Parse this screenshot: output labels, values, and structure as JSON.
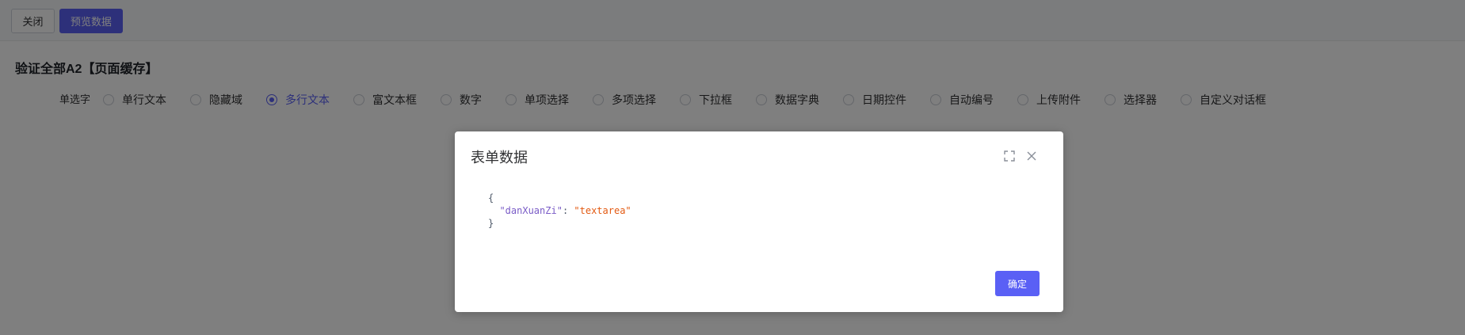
{
  "toolbar": {
    "close_label": "关闭",
    "preview_label": "预览数据"
  },
  "form": {
    "title": "验证全部A2【页面缓存】",
    "field_label": "单选字",
    "options": [
      {
        "label": "单行文本",
        "checked": false
      },
      {
        "label": "隐藏域",
        "checked": false
      },
      {
        "label": "多行文本",
        "checked": true
      },
      {
        "label": "富文本框",
        "checked": false
      },
      {
        "label": "数字",
        "checked": false
      },
      {
        "label": "单项选择",
        "checked": false
      },
      {
        "label": "多项选择",
        "checked": false
      },
      {
        "label": "下拉框",
        "checked": false
      },
      {
        "label": "数据字典",
        "checked": false
      },
      {
        "label": "日期控件",
        "checked": false
      },
      {
        "label": "自动编号",
        "checked": false
      },
      {
        "label": "上传附件",
        "checked": false
      },
      {
        "label": "选择器",
        "checked": false
      },
      {
        "label": "自定义对话框",
        "checked": false
      }
    ]
  },
  "dialog": {
    "title": "表单数据",
    "json": {
      "open": "{",
      "key": "\"danXuanZi\"",
      "colon": ": ",
      "value": "\"textarea\"",
      "close": "}"
    },
    "ok_label": "确定",
    "icons": {
      "fullscreen": "fullscreen-icon",
      "close": "close-icon"
    }
  },
  "colors": {
    "accent": "#5a60f5",
    "json_key": "#7a5cc7",
    "json_string": "#e35a12",
    "mask": "rgba(0,0,0,0.5)"
  }
}
